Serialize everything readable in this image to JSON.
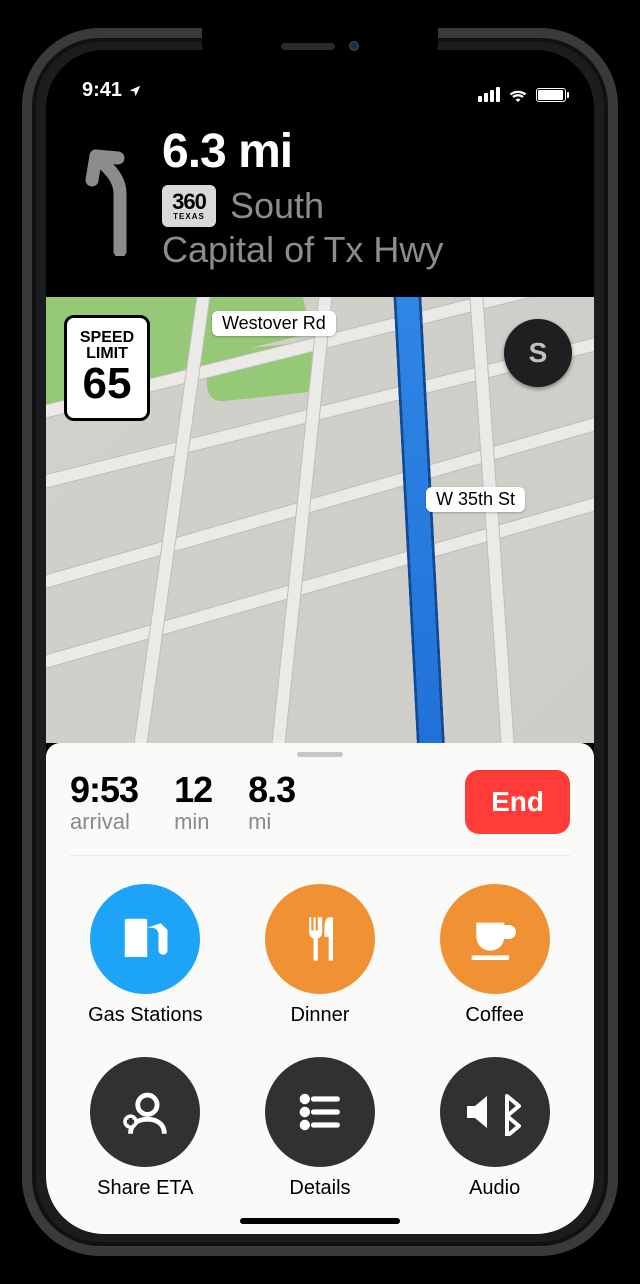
{
  "status": {
    "time": "9:41",
    "cellular_bars": 4,
    "wifi": true,
    "battery_pct": 100
  },
  "nav": {
    "distance": "6.3 mi",
    "route_shield_number": "360",
    "route_shield_state": "TEXAS",
    "direction": "South",
    "road": "Capital of Tx Hwy",
    "maneuver_icon": "turn-left-icon"
  },
  "map": {
    "speed_limit_title1": "SPEED",
    "speed_limit_title2": "LIMIT",
    "speed_limit_value": "65",
    "compass_heading": "S",
    "labels": {
      "street_1": "Westover Rd",
      "street_2": "W 35th St"
    }
  },
  "eta": {
    "arrival_value": "9:53",
    "arrival_label": "arrival",
    "duration_value": "12",
    "duration_label": "min",
    "distance_value": "8.3",
    "distance_label": "mi",
    "end_label": "End"
  },
  "actions": {
    "gas": "Gas Stations",
    "dinner": "Dinner",
    "coffee": "Coffee",
    "share": "Share ETA",
    "details": "Details",
    "audio": "Audio"
  },
  "colors": {
    "accent_blue": "#1ea4f7",
    "accent_orange": "#f09234",
    "accent_dark": "#2f3133",
    "danger": "#ff3c37",
    "route_blue": "#2f87e6"
  }
}
